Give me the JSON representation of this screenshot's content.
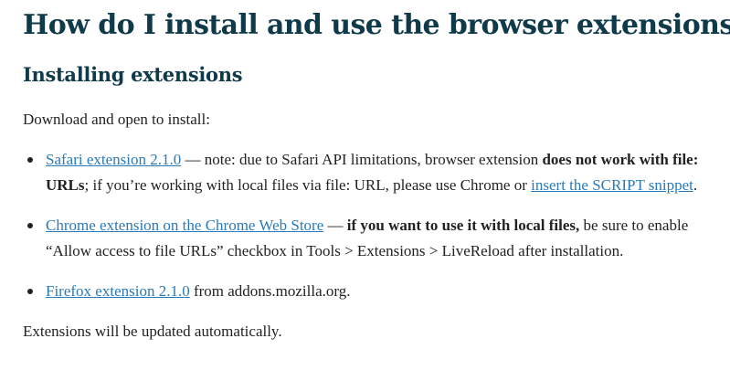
{
  "page": {
    "title": "How do I install and use the browser extensions?",
    "section_heading": "Installing extensions",
    "intro": "Download and open to install:",
    "outro": "Extensions will be updated automatically."
  },
  "extensions": [
    {
      "link_text": "Safari extension 2.1.0",
      "note_prefix": " — note: due to Safari API limitations, browser extension ",
      "note_bold": "does not work with file: URLs",
      "note_middle": "; if you’re working with local files via file: URL, please use Chrome or ",
      "note_link": "insert the SCRIPT snippet",
      "note_suffix": "."
    },
    {
      "link_text": "Chrome extension on the Chrome Web Store",
      "note_prefix": " — ",
      "note_bold": "if you want to use it with local files,",
      "note_suffix": " be sure to enable “Allow access to file URLs” checkbox in Tools > Extensions > LiveReload after installation."
    },
    {
      "link_text": "Firefox extension 2.1.0",
      "note_suffix": " from addons.mozilla.org."
    }
  ],
  "colors": {
    "heading": "#0f3a4a",
    "body_text": "#222222",
    "link": "#2a7ab9",
    "background": "#ffffff"
  }
}
